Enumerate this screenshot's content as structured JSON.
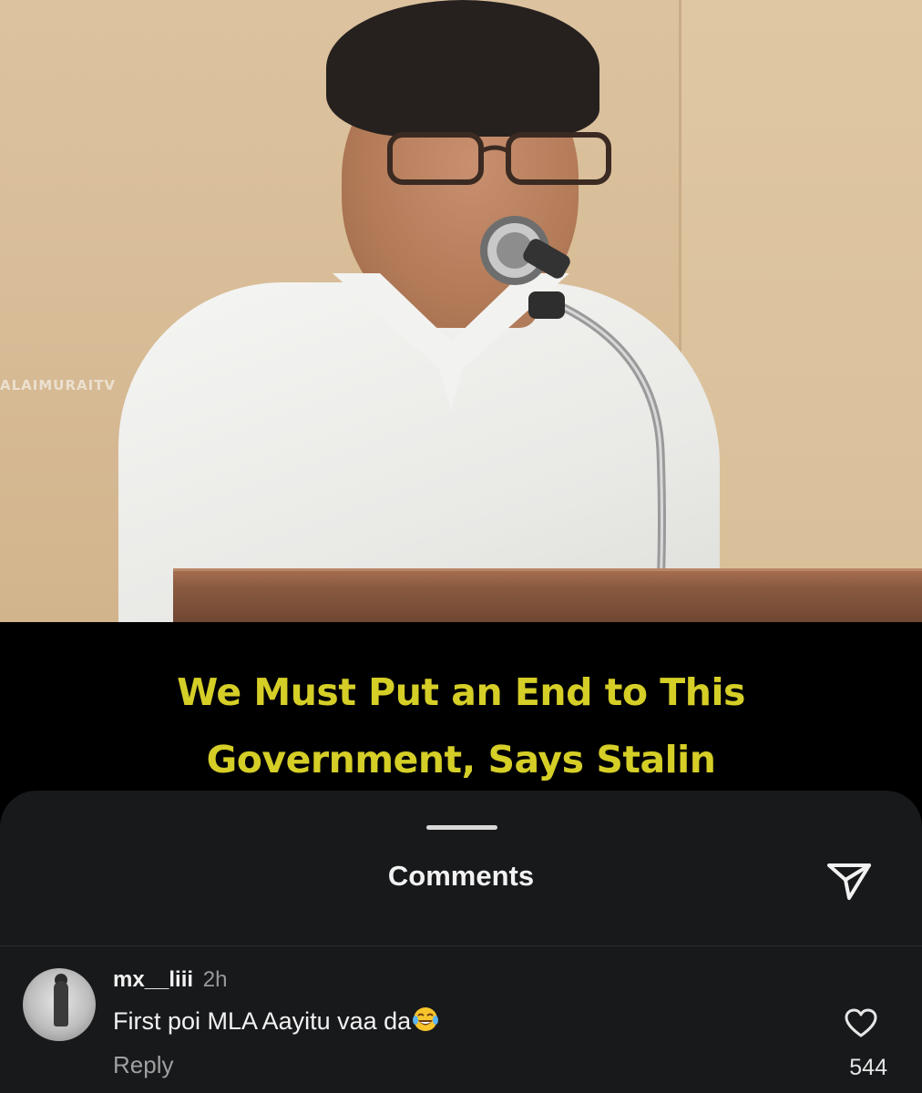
{
  "video": {
    "watermark": "ALAIMURAITV",
    "caption_line1": "We Must Put an End to This",
    "caption_line2": "Government, Says Stalin",
    "caption_color": "#d5ce27"
  },
  "comments_sheet": {
    "title": "Comments",
    "share_icon": "send-icon"
  },
  "comments": [
    {
      "username": "mx__liii",
      "time": "2h",
      "text": "First poi MLA Aayitu vaa da",
      "emoji": "face-with-tears-of-joy",
      "reply_label": "Reply",
      "like_icon": "heart-icon",
      "like_count": "544"
    }
  ]
}
